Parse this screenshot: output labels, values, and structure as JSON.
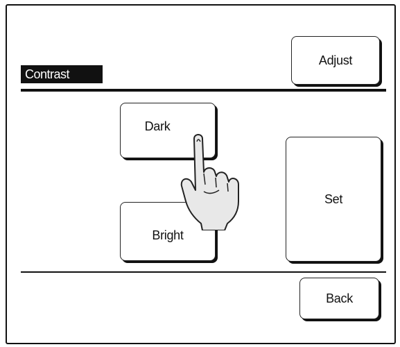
{
  "header": {
    "title": "Contrast"
  },
  "buttons": {
    "adjust": "Adjust",
    "dark": "Dark",
    "bright": "Bright",
    "set": "Set",
    "back": "Back"
  },
  "icons": {
    "pointer": "pointing-hand-icon"
  }
}
